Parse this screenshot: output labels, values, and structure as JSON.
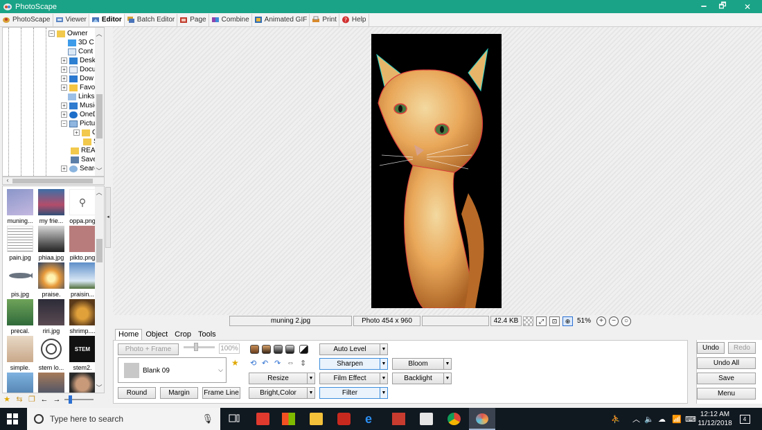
{
  "window": {
    "title": "PhotoScape",
    "minimize": "🗕",
    "maximize": "🗗",
    "close": "✕"
  },
  "menu": [
    {
      "label": "PhotoScape",
      "icon": "photoscape-icon",
      "active": false
    },
    {
      "label": "Viewer",
      "icon": "viewer-icon",
      "active": false
    },
    {
      "label": "Editor",
      "icon": "editor-icon",
      "active": true
    },
    {
      "label": "Batch Editor",
      "icon": "batch-editor-icon",
      "active": false
    },
    {
      "label": "Page",
      "icon": "page-icon",
      "active": false
    },
    {
      "label": "Combine",
      "icon": "combine-icon",
      "active": false
    },
    {
      "label": "Animated GIF",
      "icon": "animated-gif-icon",
      "active": false
    },
    {
      "label": "Print",
      "icon": "print-icon",
      "active": false
    },
    {
      "label": "Help",
      "icon": "help-icon",
      "active": false
    }
  ],
  "tree": [
    {
      "label": "Owner",
      "expander": "−"
    },
    {
      "label": "3D C",
      "expander": ""
    },
    {
      "label": "Cont",
      "expander": ""
    },
    {
      "label": "Desk",
      "expander": "+"
    },
    {
      "label": "Docu",
      "expander": "+"
    },
    {
      "label": "Dow",
      "expander": "+"
    },
    {
      "label": "Favo",
      "expander": "+"
    },
    {
      "label": "Links",
      "expander": ""
    },
    {
      "label": "Music",
      "expander": "+"
    },
    {
      "label": "OneD",
      "expander": "+"
    },
    {
      "label": "Pictu",
      "expander": "−"
    },
    {
      "label": "C",
      "expander": "+"
    },
    {
      "label": "S",
      "expander": ""
    },
    {
      "label": "REAC",
      "expander": ""
    },
    {
      "label": "Save",
      "expander": ""
    },
    {
      "label": "Searc",
      "expander": "+"
    }
  ],
  "thumbnails": [
    {
      "label": "muning..."
    },
    {
      "label": "my frie..."
    },
    {
      "label": "oppa.png"
    },
    {
      "label": "pain.jpg"
    },
    {
      "label": "phiaa.jpg"
    },
    {
      "label": "pikto.png"
    },
    {
      "label": "pis.jpg"
    },
    {
      "label": "praise."
    },
    {
      "label": "praisin..."
    },
    {
      "label": "precal."
    },
    {
      "label": "riri.jpg"
    },
    {
      "label": "shrimp...."
    },
    {
      "label": "simple."
    },
    {
      "label": "stem lo..."
    },
    {
      "label": "stem2."
    },
    {
      "label": ""
    },
    {
      "label": ""
    },
    {
      "label": ""
    }
  ],
  "thumb_texts": {
    "stem": "STEM"
  },
  "status": {
    "filename": "muning 2.jpg",
    "dimensions": "Photo 454 x 960",
    "blank": "",
    "filesize": "42.4 KB",
    "zoom": "51%"
  },
  "tabs": [
    "Home",
    "Object",
    "Crop",
    "Tools"
  ],
  "home": {
    "photo_frame": "Photo + Frame",
    "frame_percent": "100%",
    "frame_name": "Blank 09",
    "round": "Round",
    "margin": "Margin",
    "frame_line": "Frame Line",
    "auto_level": "Auto Level",
    "sharpen": "Sharpen",
    "bloom": "Bloom",
    "resize": "Resize",
    "film_effect": "Film Effect",
    "backlight": "Backlight",
    "bright_color": "Bright,Color",
    "filter": "Filter"
  },
  "actions": {
    "undo": "Undo",
    "redo": "Redo",
    "undo_all": "Undo All",
    "save": "Save",
    "menu": "Menu"
  },
  "taskbar": {
    "search_placeholder": "Type here to search",
    "time": "12:12 AM",
    "date": "11/12/2018",
    "notifications": "4"
  }
}
